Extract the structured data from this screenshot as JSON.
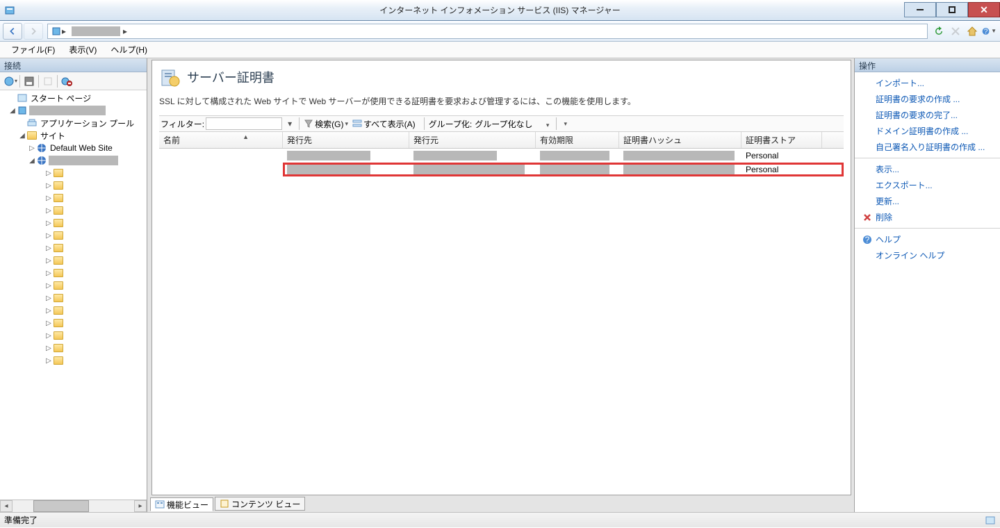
{
  "window": {
    "title": "インターネット インフォメーション サービス (IIS) マネージャー"
  },
  "menubar": {
    "file": "ファイル(F)",
    "view": "表示(V)",
    "help": "ヘルプ(H)"
  },
  "leftPanel": {
    "header": "接続",
    "tree": {
      "start": "スタート ページ",
      "appPools": "アプリケーション プール",
      "sites": "サイト",
      "defaultSite": "Default Web Site"
    }
  },
  "content": {
    "title": "サーバー証明書",
    "description": "SSL に対して構成された Web サイトで Web サーバーが使用できる証明書を要求および管理するには、この機能を使用します。",
    "filter": {
      "label": "フィルター:",
      "search": "検索(G)",
      "showAll": "すべて表示(A)",
      "groupLabel": "グループ化:",
      "groupValue": "グループ化なし"
    },
    "columns": {
      "name": "名前",
      "issuedTo": "発行先",
      "issuedBy": "発行元",
      "expiry": "有効期限",
      "hash": "証明書ハッシュ",
      "store": "証明書ストア"
    },
    "rows": [
      {
        "store": "Personal",
        "highlighted": false
      },
      {
        "store": "Personal",
        "highlighted": true
      }
    ],
    "viewTabs": {
      "feature": "機能ビュー",
      "content": "コンテンツ ビュー"
    }
  },
  "actionsPanel": {
    "header": "操作",
    "items": [
      {
        "label": "インポート...",
        "icon": ""
      },
      {
        "label": "証明書の要求の作成 ...",
        "icon": ""
      },
      {
        "label": "証明書の要求の完了...",
        "icon": ""
      },
      {
        "label": "ドメイン証明書の作成 ...",
        "icon": ""
      },
      {
        "label": "自己署名入り証明書の作成 ...",
        "icon": ""
      },
      {
        "type": "divider"
      },
      {
        "label": "表示...",
        "icon": ""
      },
      {
        "label": "エクスポート...",
        "icon": ""
      },
      {
        "label": "更新...",
        "icon": ""
      },
      {
        "label": "削除",
        "icon": "x"
      },
      {
        "type": "divider"
      },
      {
        "label": "ヘルプ",
        "icon": "help"
      },
      {
        "label": "オンライン ヘルプ",
        "icon": ""
      }
    ]
  },
  "statusbar": {
    "text": "準備完了"
  }
}
